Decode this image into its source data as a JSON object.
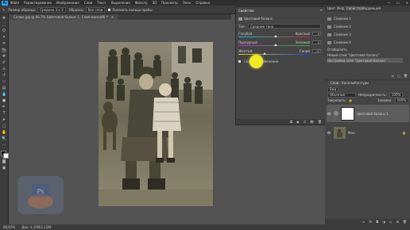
{
  "app": {
    "logo": "Ps"
  },
  "menu": [
    "Файл",
    "Редактирование",
    "Изображение",
    "Слои",
    "Текст",
    "Выделение",
    "Фильтр",
    "3D",
    "Просмотр",
    "Окно",
    "Справка"
  ],
  "options_bar": {
    "size_label": "Размер образца:",
    "size_value": "Среднее 3 х 3",
    "sample_label": "Образец:",
    "sample_value": "Все слои",
    "ring_label": "Показать кольцо пробы"
  },
  "document_tab": "Селюк.jpg @ 66,7% (Цветовой баланс 1, Слой-маска/8) *",
  "properties": {
    "tab": "Свойства",
    "subtitle": "Цветовой баланс",
    "tone_label": "Тон:",
    "tone_value": "Средние тона",
    "sliders": [
      {
        "left": "Голубой",
        "right": "Красный",
        "value": "0",
        "position": 0.5,
        "left_color": "#00c8d8",
        "right_color": "#e02020"
      },
      {
        "left": "Пурпурный",
        "right": "Зеленый",
        "value": "0",
        "position": 0.5,
        "left_color": "#d020d0",
        "right_color": "#20c020"
      },
      {
        "left": "Желтый",
        "right": "Синий",
        "value": "-32",
        "position": 0.34,
        "left_color": "#e0d020",
        "right_color": "#2040e0"
      }
    ],
    "preserve_label": "Сохранить свечение"
  },
  "dock": {
    "tabs_top": [
      "Цвет",
      "Инфо",
      "Свойства",
      "Коррекция"
    ],
    "history_items": [
      "Слияние 1",
      "Слияние 2",
      "Слияние 3",
      "Слияние 4",
      "Отобразить",
      "Новый слой \"Цветовой баланс\"",
      "Настройка слоя \"Цветовой баланс\""
    ],
    "layers_tabs": [
      "Слои",
      "Каналы",
      "Контуры"
    ],
    "kind_label": "Вид",
    "blend_mode": "Обычные",
    "opacity_label": "Непрозрачность:",
    "opacity_value": "100%",
    "lock_label": "Закрепить:",
    "fill_label": "Заливка:",
    "fill_value": "100%",
    "layers": [
      {
        "name": "Цветовой баланс 1",
        "selected": true
      },
      {
        "name": "Фон",
        "selected": false
      }
    ]
  },
  "status": {
    "zoom": "66,67%",
    "doc": "Док: 1,15M/1,15M"
  },
  "colors": {
    "accent": "#31a8ff",
    "panel": "#454545",
    "cursor": "#f2ea20"
  }
}
